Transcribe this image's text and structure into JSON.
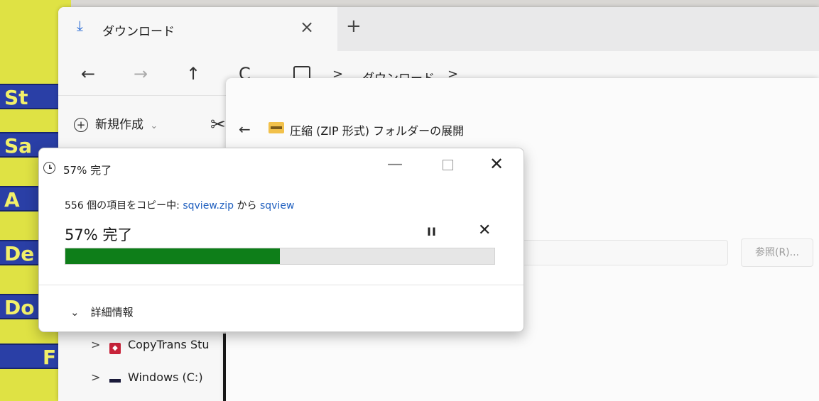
{
  "desktop": {
    "icons": [
      "St",
      "Sa",
      "A",
      "De",
      "Do",
      "F"
    ]
  },
  "explorer": {
    "tab": {
      "label": "ダウンロード",
      "icon": "download-icon",
      "close": "×",
      "new_tab": "+"
    },
    "nav": {
      "back": "←",
      "forward": "→",
      "up": "↑",
      "refresh": "C"
    },
    "breadcrumb": {
      "separator": ">",
      "current": "ダウンロード",
      "trailing": ">"
    },
    "command_bar": {
      "new_label": "新規作成",
      "new_chevron": "⌄"
    },
    "sidebar": {
      "items": [
        {
          "label": "CopyTrans Stu",
          "icon": "copytrans-icon"
        },
        {
          "label": "Windows (C:)",
          "icon": "drive-icon"
        }
      ]
    }
  },
  "wizard": {
    "title": "圧縮 (ZIP 形式) フォルダーの展開",
    "browse_label": "参照(R)..."
  },
  "progress_dialog": {
    "title": "57% 完了",
    "status_prefix": "556 個の項目をコピー中: ",
    "source": "sqview.zip",
    "from_word": " から ",
    "destination": "sqview",
    "percent_label": "57% 完了",
    "progress_fraction": 0.5,
    "details_label": "詳細情報",
    "accent_color": "#0e7e19"
  }
}
